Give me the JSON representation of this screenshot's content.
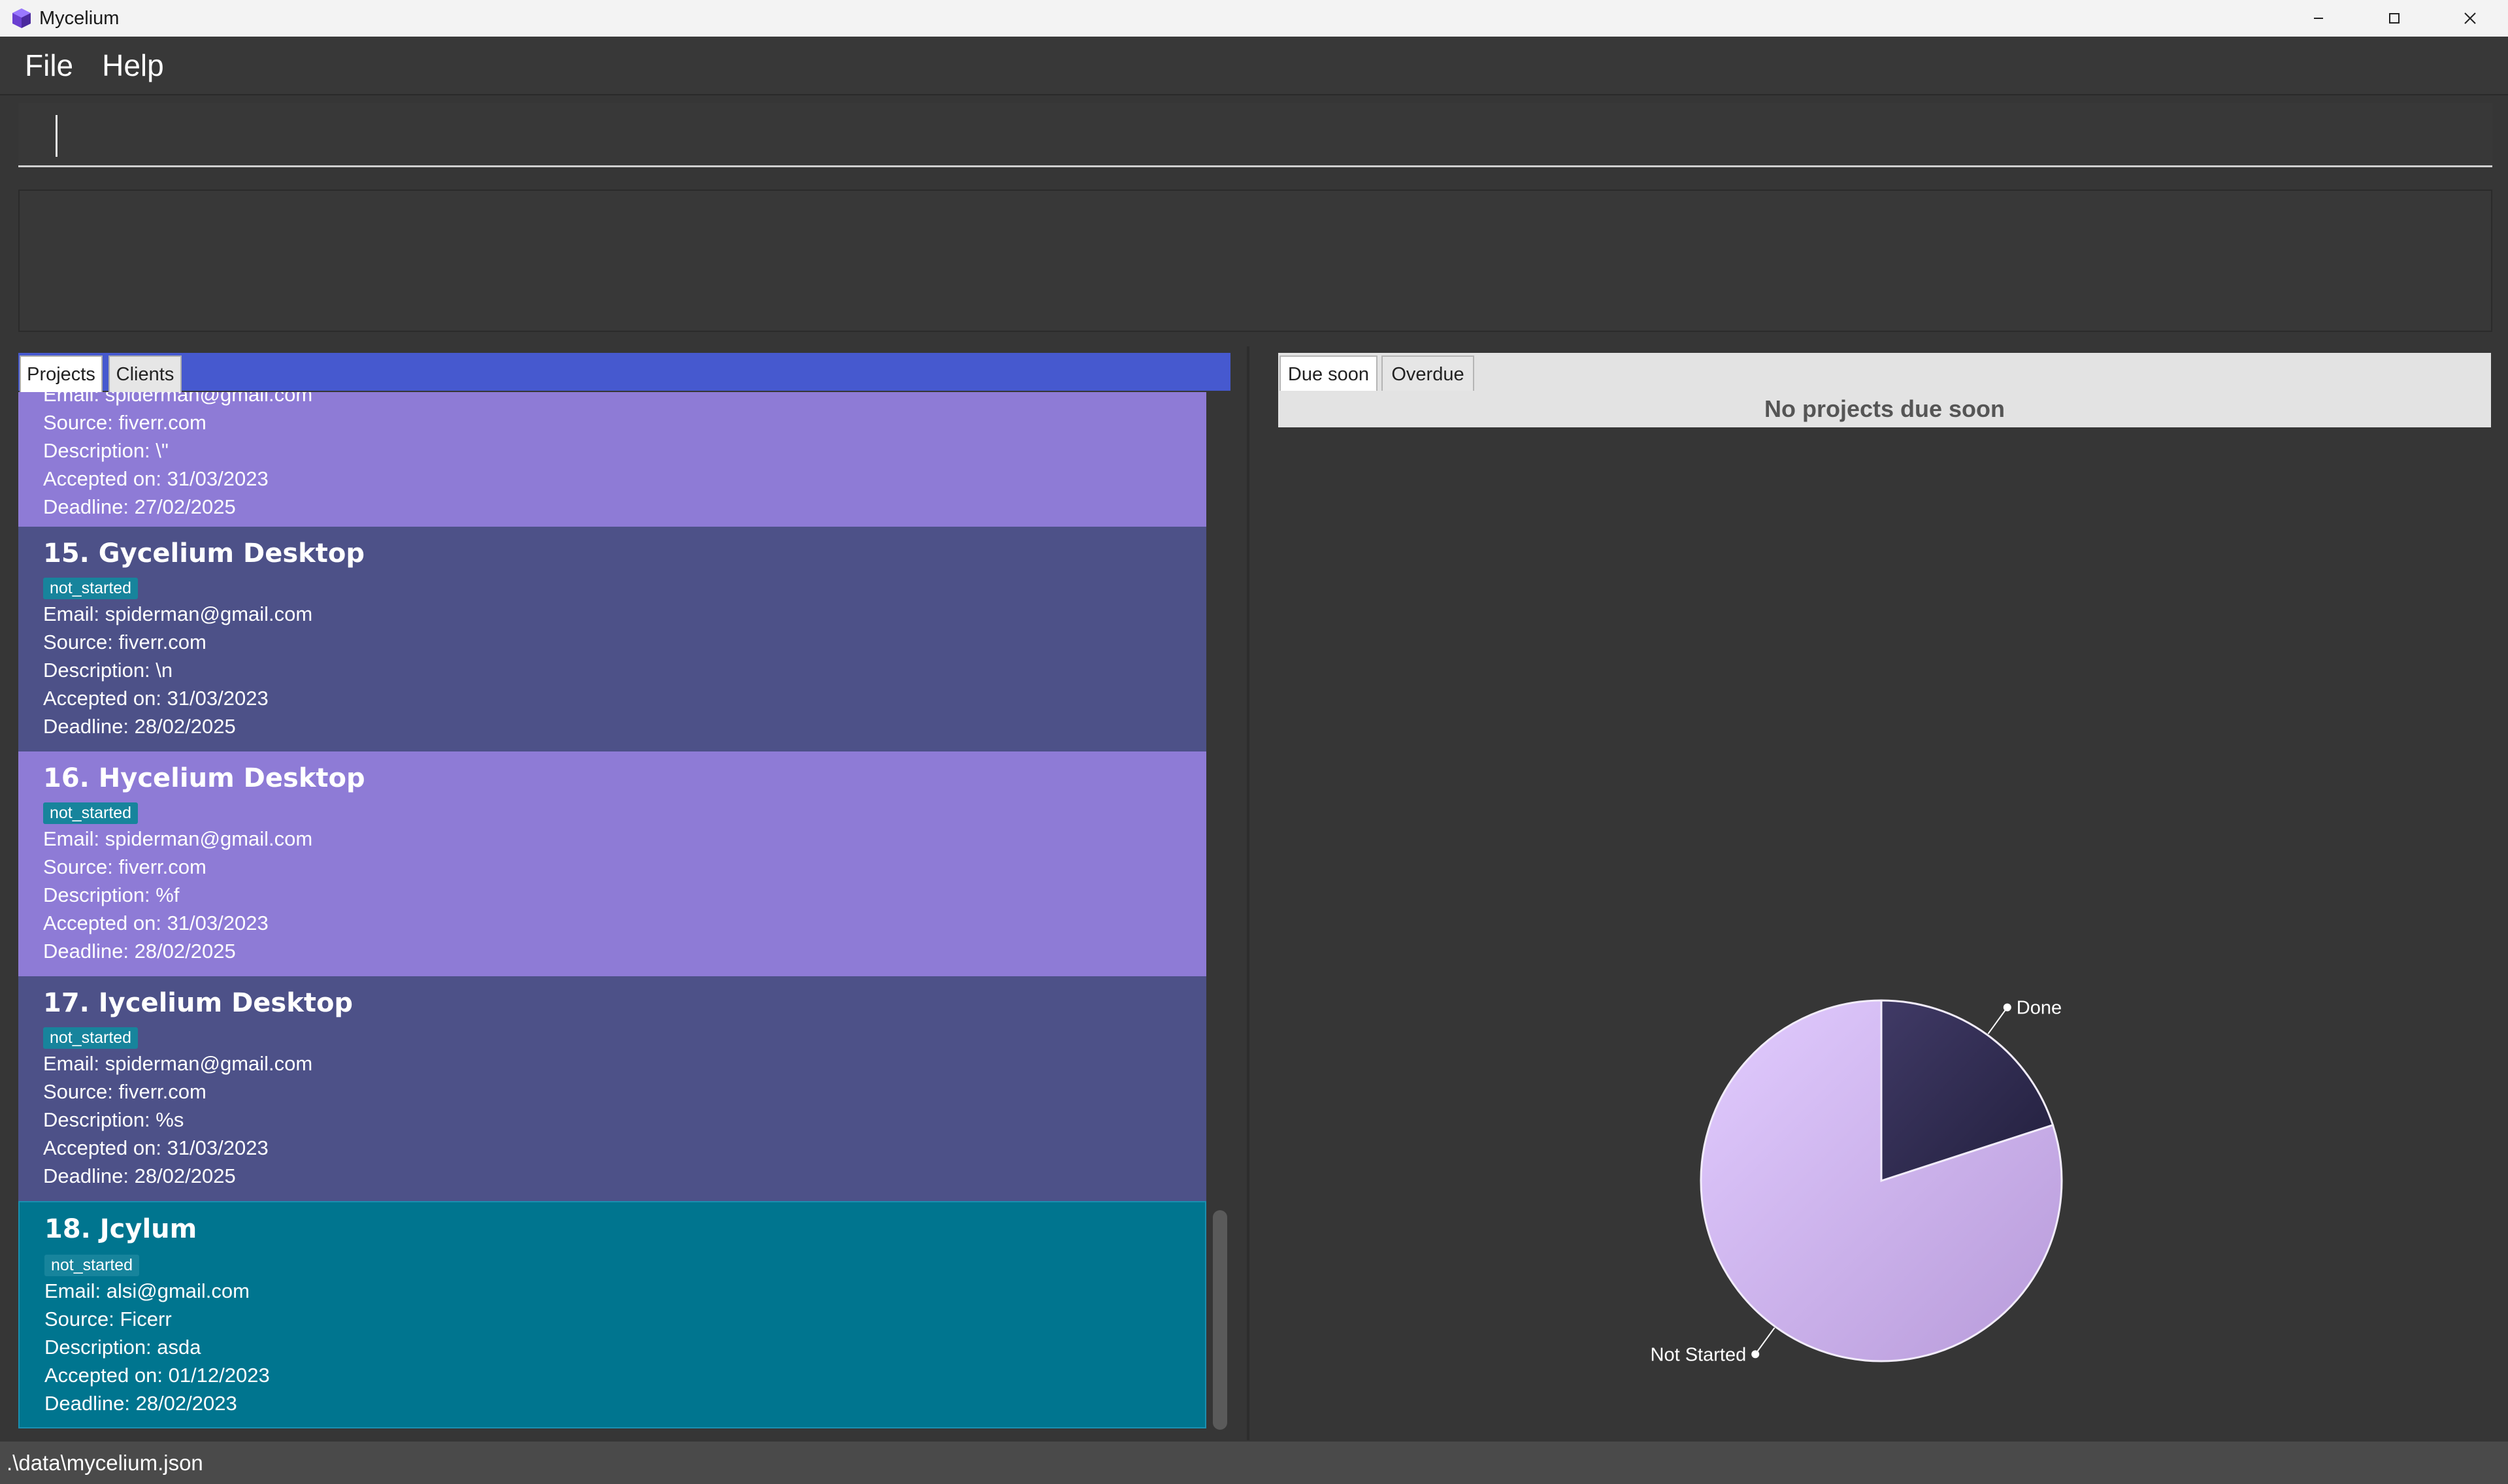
{
  "window": {
    "title": "Mycelium",
    "controls": [
      "minimize",
      "maximize",
      "close"
    ]
  },
  "menu": {
    "items": [
      {
        "label": "File"
      },
      {
        "label": "Help"
      }
    ]
  },
  "command_box": {
    "value": "",
    "placeholder": ""
  },
  "result_display": {
    "text": ""
  },
  "left_tabs": {
    "projects": "Projects",
    "clients": "Clients"
  },
  "projects": [
    {
      "title": "",
      "status": "",
      "email": "Email: spiderman@gmail.com",
      "source": "Source: fiverr.com",
      "description": "Description: \\\"",
      "accepted": "Accepted on: 31/03/2023",
      "deadline": "Deadline: 27/02/2025"
    },
    {
      "title": "15.  Gycelium Desktop",
      "status": "not_started",
      "email": "Email: spiderman@gmail.com",
      "source": "Source: fiverr.com",
      "description": "Description: \\n",
      "accepted": "Accepted on: 31/03/2023",
      "deadline": "Deadline: 28/02/2025"
    },
    {
      "title": "16.  Hycelium Desktop",
      "status": "not_started",
      "email": "Email: spiderman@gmail.com",
      "source": "Source: fiverr.com",
      "description": "Description: %f",
      "accepted": "Accepted on: 31/03/2023",
      "deadline": "Deadline: 28/02/2025"
    },
    {
      "title": "17.  Iycelium Desktop",
      "status": "not_started",
      "email": "Email: spiderman@gmail.com",
      "source": "Source: fiverr.com",
      "description": "Description: %s",
      "accepted": "Accepted on: 31/03/2023",
      "deadline": "Deadline: 28/02/2025"
    },
    {
      "title": "18.  Jcylum",
      "status": "not_started",
      "email": "Email: alsi@gmail.com",
      "source": "Source: Ficerr",
      "description": "Description: asda",
      "accepted": "Accepted on: 01/12/2023",
      "deadline": "Deadline: 28/02/2023"
    }
  ],
  "right_tabs": {
    "due_soon": "Due soon",
    "overdue": "Overdue"
  },
  "due_soon_message": "No projects due soon",
  "pie": {
    "slices": [
      {
        "label": "Done",
        "fraction": 0.2,
        "color": "#2f2b4e"
      },
      {
        "label": "Not Started",
        "fraction": 0.8,
        "color": "#cbb2e6"
      }
    ]
  },
  "status_bar": {
    "path": ".\\data\\mycelium.json"
  },
  "colors": {
    "tabs_header": "#4659cf",
    "card_violet": "#8e7bd6",
    "card_slate": "#4d5188",
    "card_selected": "#00758f",
    "badge": "#17849c"
  }
}
